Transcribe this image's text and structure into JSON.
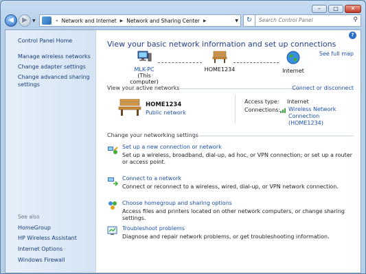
{
  "window": {
    "caption_buttons": [
      "–",
      "□",
      "✕"
    ]
  },
  "address_bar": {
    "breadcrumb_prefix": "«",
    "breadcrumb": [
      "Network and Internet",
      "Network and Sharing Center"
    ],
    "search_placeholder": "Search Control Panel"
  },
  "sidebar": {
    "home": "Control Panel Home",
    "items": [
      "Manage wireless networks",
      "Change adapter settings",
      "Change advanced sharing settings"
    ],
    "see_also_heading": "See also",
    "see_also": [
      "HomeGroup",
      "HP Wireless Assistant",
      "Internet Options",
      "Windows Firewall"
    ]
  },
  "main": {
    "title": "View your basic network information and set up connections",
    "see_full_map": "See full map",
    "map": {
      "computer": {
        "name": "MLK-PC",
        "sub": "(This computer)"
      },
      "network": {
        "name": "HOME1234"
      },
      "internet": {
        "name": "Internet"
      }
    },
    "active_networks": {
      "heading": "View your active networks",
      "connect_link": "Connect or disconnect",
      "network_name": "HOME1234",
      "network_type": "Public network",
      "access_type_label": "Access type:",
      "access_type_value": "Internet",
      "connections_label": "Connections:",
      "connection_link_line1": "Wireless Network Connection",
      "connection_link_line2": "(HOME1234)"
    },
    "settings": {
      "heading": "Change your networking settings",
      "tasks": [
        {
          "title": "Set up a new connection or network",
          "desc": "Set up a wireless, broadband, dial-up, ad hoc, or VPN connection; or set up a router or access point."
        },
        {
          "title": "Connect to a network",
          "desc": "Connect or reconnect to a wireless, wired, dial-up, or VPN network connection."
        },
        {
          "title": "Choose homegroup and sharing options",
          "desc": "Access files and printers located on other network computers, or change sharing settings."
        },
        {
          "title": "Troubleshoot problems",
          "desc": "Diagnose and repair network problems, or get troubleshooting information."
        }
      ]
    }
  },
  "colors": {
    "link": "#1a50a8",
    "title": "#1e3d8f",
    "sidebar_link": "#1a3d7a"
  }
}
